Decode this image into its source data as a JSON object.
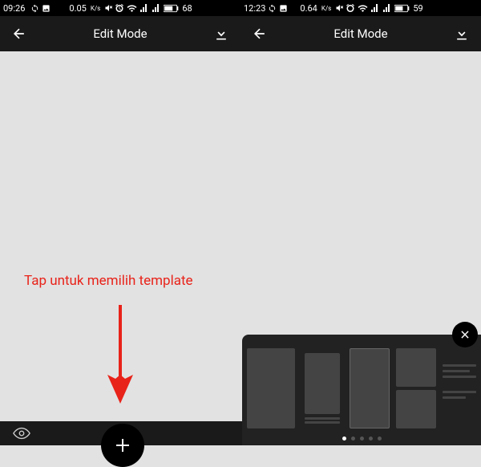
{
  "left_screen": {
    "status": {
      "time": "09:26",
      "net_speed": "0.05",
      "net_unit": "K/s",
      "battery": "68"
    },
    "header": {
      "title": "Edit Mode"
    }
  },
  "right_screen": {
    "status": {
      "time": "12:23",
      "net_speed": "0.64",
      "net_unit": "K/s",
      "battery": "59"
    },
    "header": {
      "title": "Edit Mode"
    }
  },
  "annotation": {
    "text": "Tap untuk memilih template",
    "color": "#e8231a"
  },
  "template_panel": {
    "page_count": 5,
    "active_page": 0
  }
}
